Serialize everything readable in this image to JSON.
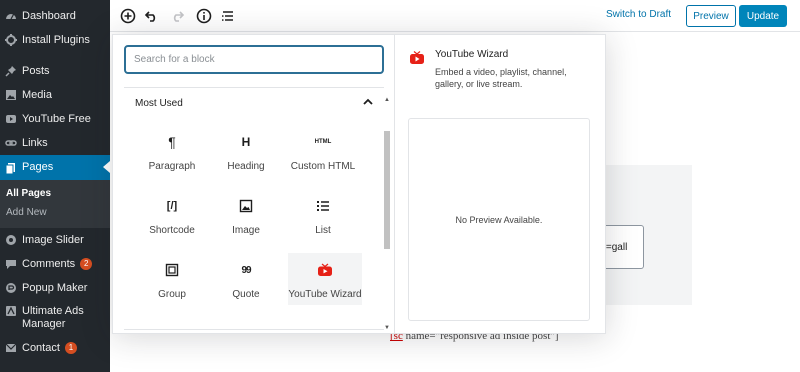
{
  "sidebar": {
    "items": [
      {
        "label": "Dashboard",
        "icon": "dashboard-icon"
      },
      {
        "label": "Install Plugins",
        "icon": "plugin-icon"
      },
      {
        "label": "Posts",
        "icon": "pin-icon"
      },
      {
        "label": "Media",
        "icon": "media-icon"
      },
      {
        "label": "YouTube Free",
        "icon": "youtube-icon"
      },
      {
        "label": "Links",
        "icon": "link-icon"
      },
      {
        "label": "Pages",
        "icon": "pages-icon"
      },
      {
        "label": "Image Slider",
        "icon": "slider-icon"
      },
      {
        "label": "Comments",
        "icon": "comment-icon",
        "badge": "2"
      },
      {
        "label": "Popup Maker",
        "icon": "popup-icon"
      },
      {
        "label": "Ultimate Ads Manager",
        "icon": "ads-icon"
      },
      {
        "label": "Contact",
        "icon": "mail-icon",
        "badge": "1"
      }
    ],
    "submenu": {
      "all_pages": "All Pages",
      "add_new": "Add New"
    }
  },
  "toolbar": {
    "switch_draft": "Switch to Draft",
    "preview": "Preview",
    "update": "Update"
  },
  "inserter": {
    "search_placeholder": "Search for a block",
    "panel_title": "Most Used",
    "blocks": [
      {
        "label": "Paragraph",
        "icon": "paragraph-icon",
        "glyph": "¶"
      },
      {
        "label": "Heading",
        "icon": "heading-icon",
        "glyph": "H"
      },
      {
        "label": "Custom HTML",
        "icon": "html-icon",
        "glyph": "HTML"
      },
      {
        "label": "Shortcode",
        "icon": "shortcode-icon",
        "glyph": "[/]"
      },
      {
        "label": "Image",
        "icon": "image-icon",
        "glyph": ""
      },
      {
        "label": "List",
        "icon": "list-icon",
        "glyph": ""
      },
      {
        "label": "Group",
        "icon": "group-icon",
        "glyph": ""
      },
      {
        "label": "Quote",
        "icon": "quote-icon",
        "glyph": "99"
      },
      {
        "label": "YouTube Wizard",
        "icon": "youtube-icon",
        "glyph": ""
      }
    ],
    "preview": {
      "title": "YouTube Wizard",
      "description": "Embed a video, playlist, channel, gallery, or live stream.",
      "empty": "No Preview Available."
    }
  },
  "editor": {
    "shortcode_fragment": "out=gall",
    "shortcode_bracket": "[sc",
    "below_line_rest": " name=\"responsive ad inside post\"]"
  },
  "colors": {
    "sidebar_bg": "#23282d",
    "accent": "#0073aa",
    "badge": "#d54e21",
    "youtube_red": "#e62117"
  }
}
